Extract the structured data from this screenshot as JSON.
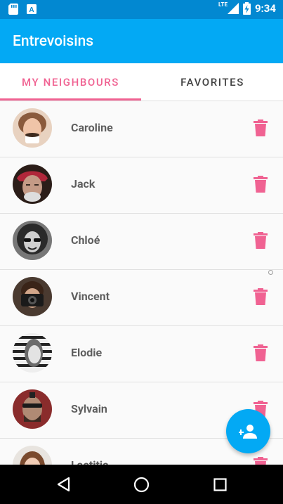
{
  "status_bar": {
    "time": "9:34",
    "network": "LTE"
  },
  "app_bar": {
    "title": "Entrevoisins"
  },
  "tabs": [
    {
      "label": "MY NEIGHBOURS"
    },
    {
      "label": "FAVORITES"
    }
  ],
  "neighbours": [
    {
      "name": "Caroline"
    },
    {
      "name": "Jack"
    },
    {
      "name": "Chloé"
    },
    {
      "name": "Vincent"
    },
    {
      "name": "Elodie"
    },
    {
      "name": "Sylvain"
    },
    {
      "name": "Laetitia"
    }
  ],
  "colors": {
    "primary": "#03a9f4",
    "primary_dark": "#0288d1",
    "accent": "#f06292"
  }
}
